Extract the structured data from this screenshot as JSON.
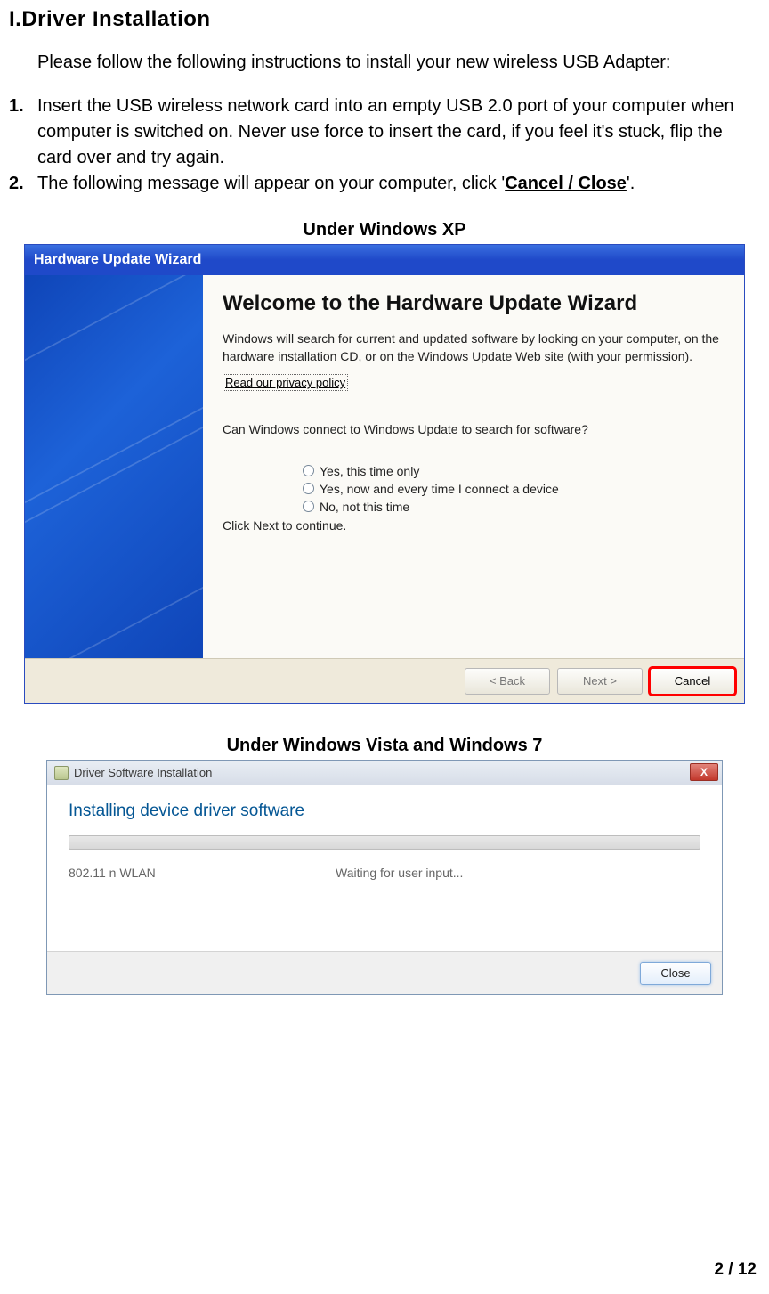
{
  "heading": "I.Driver Installation",
  "intro": "Please follow the following instructions to install your new wireless USB Adapter:",
  "steps": {
    "s1_num": "1.",
    "s1_text": "Insert the USB wireless network card into an empty USB 2.0 port of your computer when computer is switched on. Never use force to insert the card, if you feel it's stuck, flip the card over and try again.",
    "s2_num": "2.",
    "s2_prefix": "The following message will appear on your computer, click '",
    "s2_link": "Cancel / Close",
    "s2_suffix": "'."
  },
  "xp_caption": "Under Windows XP",
  "xp": {
    "titlebar": "Hardware Update Wizard",
    "heading": "Welcome to the Hardware Update Wizard",
    "p1": "Windows will search for current and updated software by looking on your computer, on the hardware installation CD, or on the Windows Update Web site (with your permission).",
    "link": "Read our privacy policy",
    "question": "Can Windows connect to Windows Update to search for software?",
    "r1": "Yes, this time only",
    "r2": "Yes, now and every time I connect a device",
    "r3": "No, not this time",
    "continue": "Click Next to continue.",
    "back": "< Back",
    "next": "Next >",
    "cancel": "Cancel"
  },
  "vista_caption": "Under Windows Vista and Windows 7",
  "vista": {
    "titlebar": "Driver Software Installation",
    "close_x": "X",
    "headline": "Installing device driver software",
    "device": "802.11 n WLAN",
    "status": "Waiting for user input...",
    "close": "Close"
  },
  "page_number": "2 / 12"
}
